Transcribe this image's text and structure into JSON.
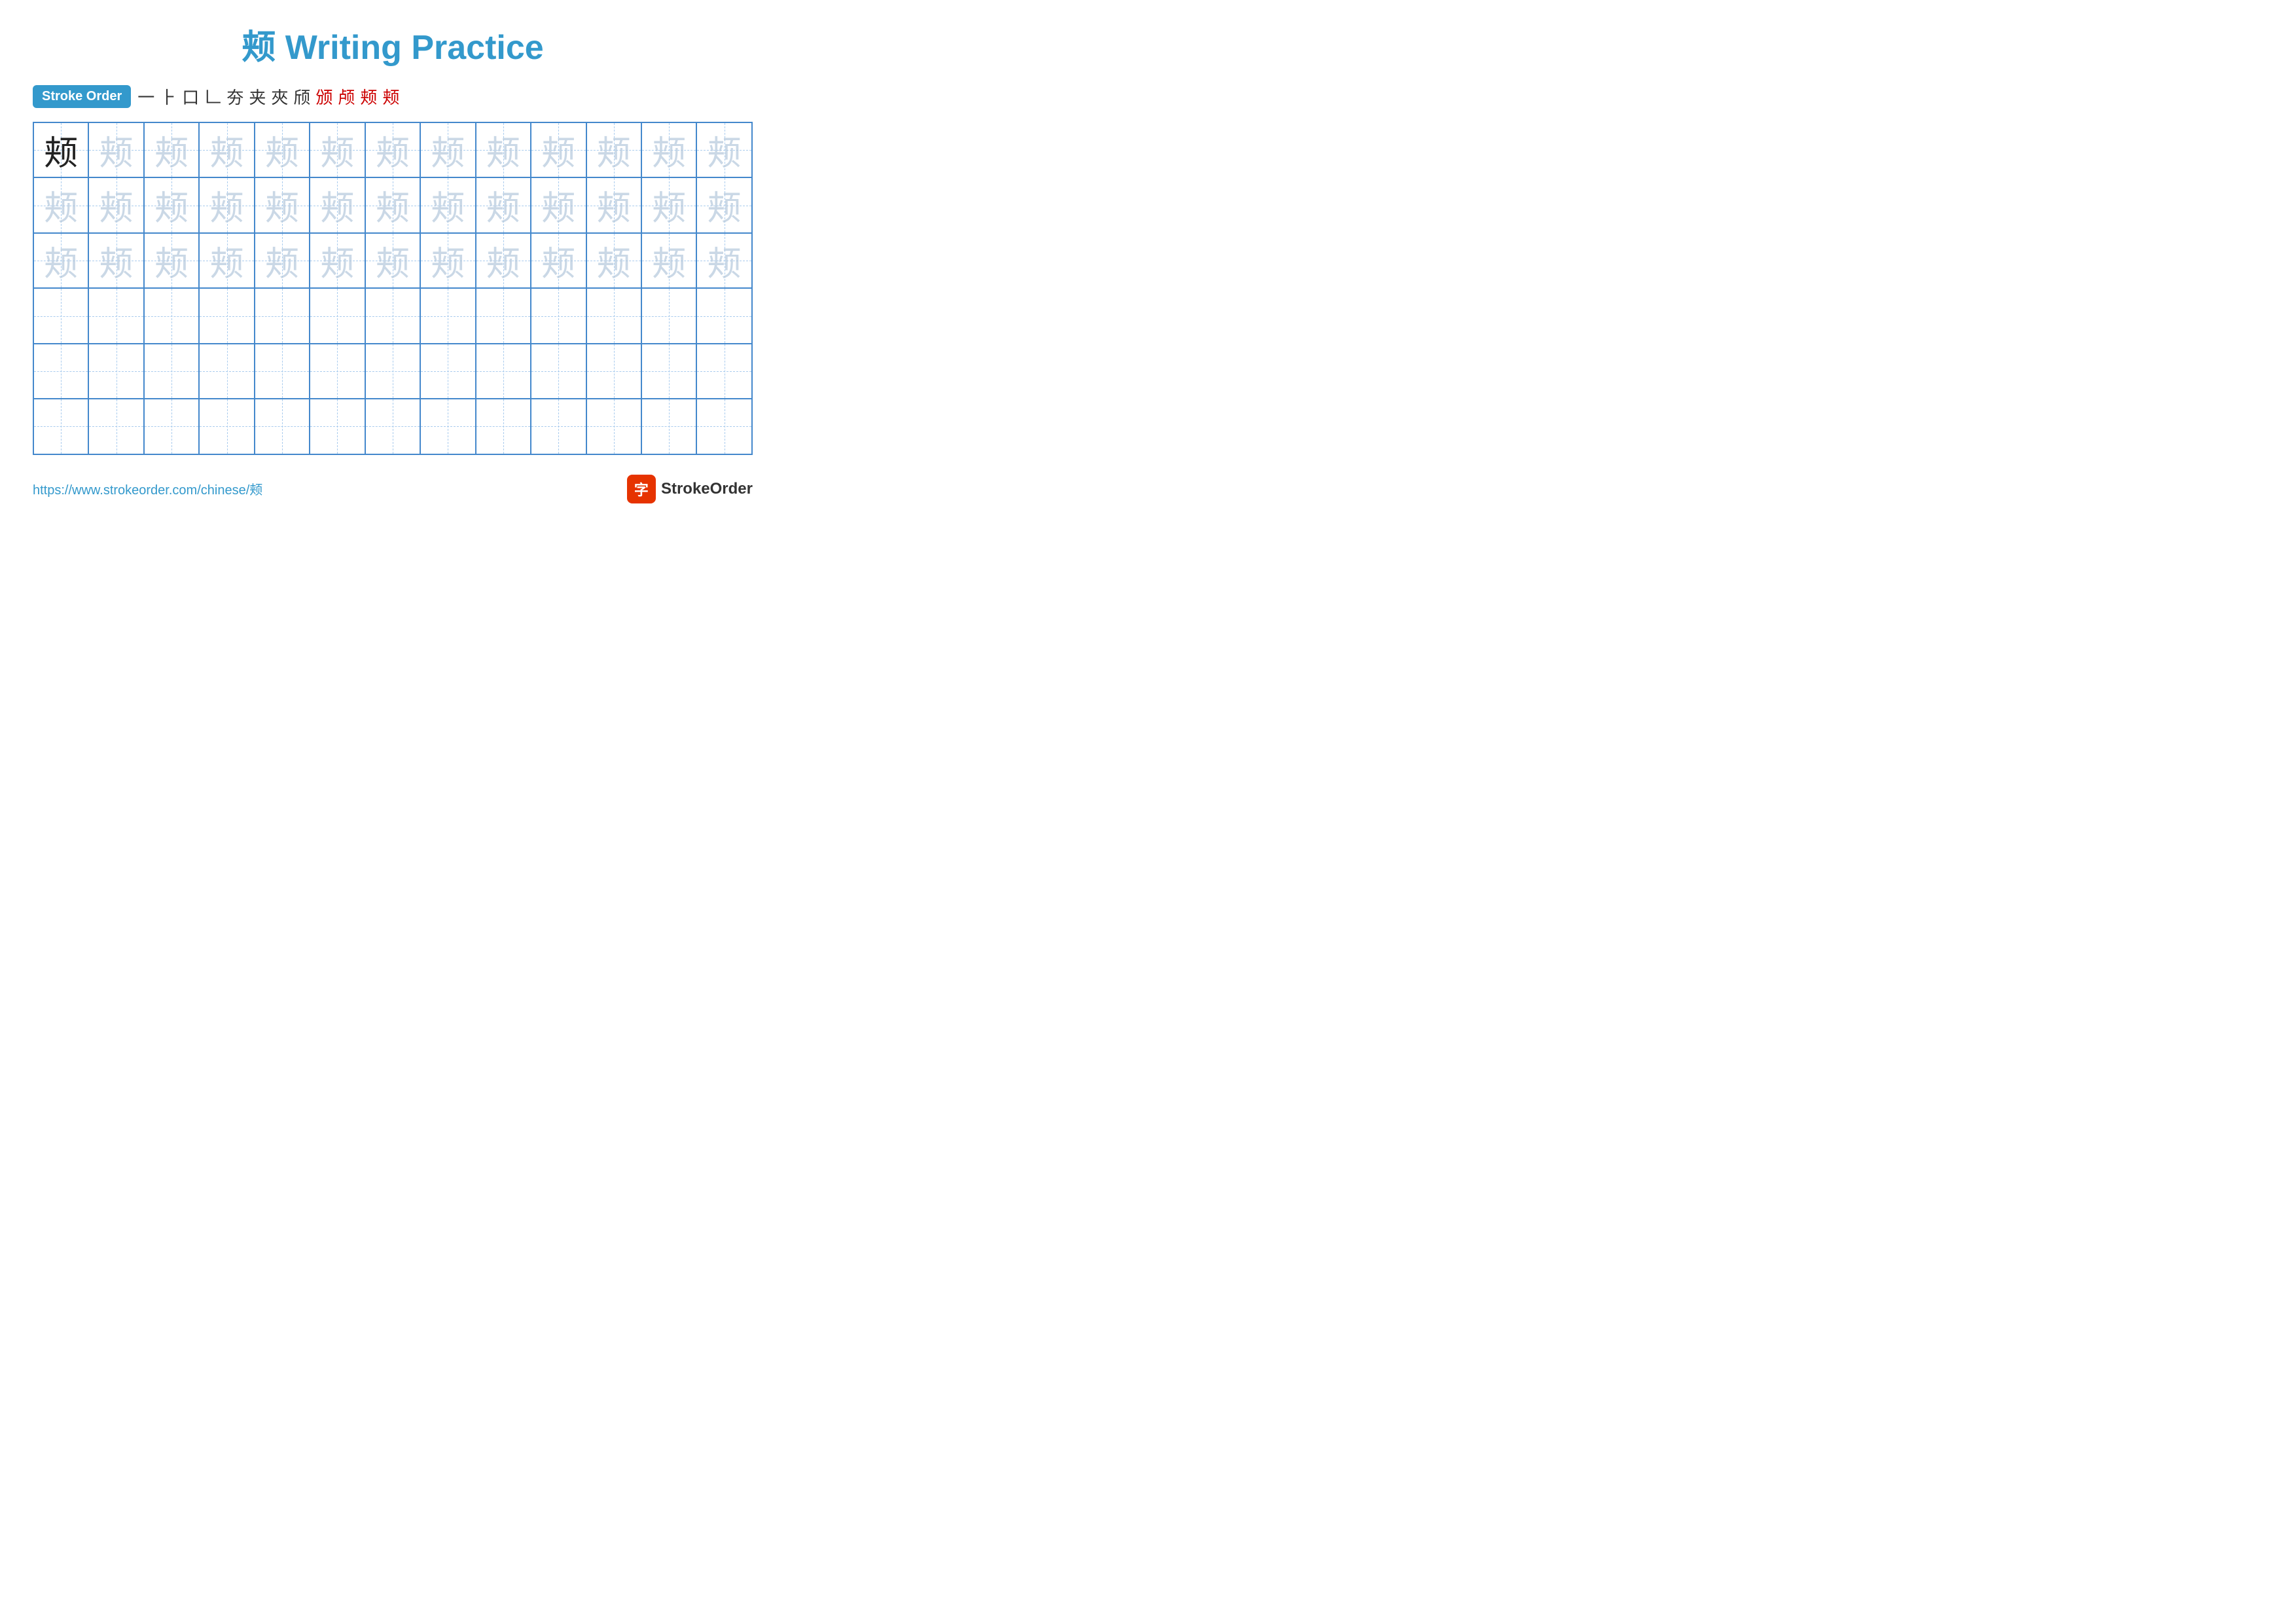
{
  "page": {
    "title": "颊 Writing Practice",
    "char": "颊",
    "url": "https://www.strokeorder.com/chinese/颊",
    "logo_label": "StrokeOrder",
    "logo_icon": "字"
  },
  "stroke_order": {
    "badge": "Stroke Order",
    "steps": [
      "一",
      "⺊",
      "口",
      "⺕",
      "夯",
      "夹",
      "夹⁻",
      "夹⁺",
      "颁",
      "颁̣",
      "颊",
      "颊"
    ]
  },
  "grid": {
    "rows": 6,
    "cols": 13,
    "row_types": [
      "dark_then_light",
      "light_only",
      "light_only",
      "empty",
      "empty",
      "empty"
    ]
  }
}
